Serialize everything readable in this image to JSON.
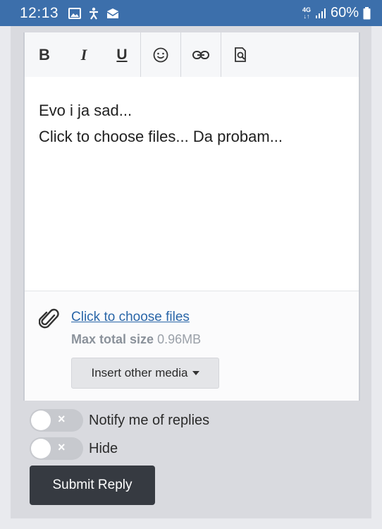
{
  "status_bar": {
    "time": "12:13",
    "left_icons": [
      "image-icon",
      "accessibility-icon",
      "mail-icon"
    ],
    "network_top": "4G",
    "network_bottom": "↓↑",
    "battery_percent": "60%"
  },
  "toolbar": {
    "bold_label": "B",
    "italic_label": "I",
    "underline_label": "U",
    "icons": [
      "smiley-icon",
      "link-icon",
      "preview-icon"
    ]
  },
  "editor": {
    "lines": [
      "Evo i ja sad...",
      "Click to choose files... Da probam..."
    ]
  },
  "attachments": {
    "choose_link": "Click to choose files",
    "max_label": "Max total size",
    "max_value": "0.96MB",
    "insert_button": "Insert other media"
  },
  "options": {
    "notify_label": "Notify me of replies",
    "hide_label": "Hide",
    "toggle_off_symbol": "×"
  },
  "submit_label": "Submit Reply",
  "colors": {
    "status_bar": "#3c6fab",
    "link": "#2a66a8",
    "submit_bg": "#363a41"
  }
}
